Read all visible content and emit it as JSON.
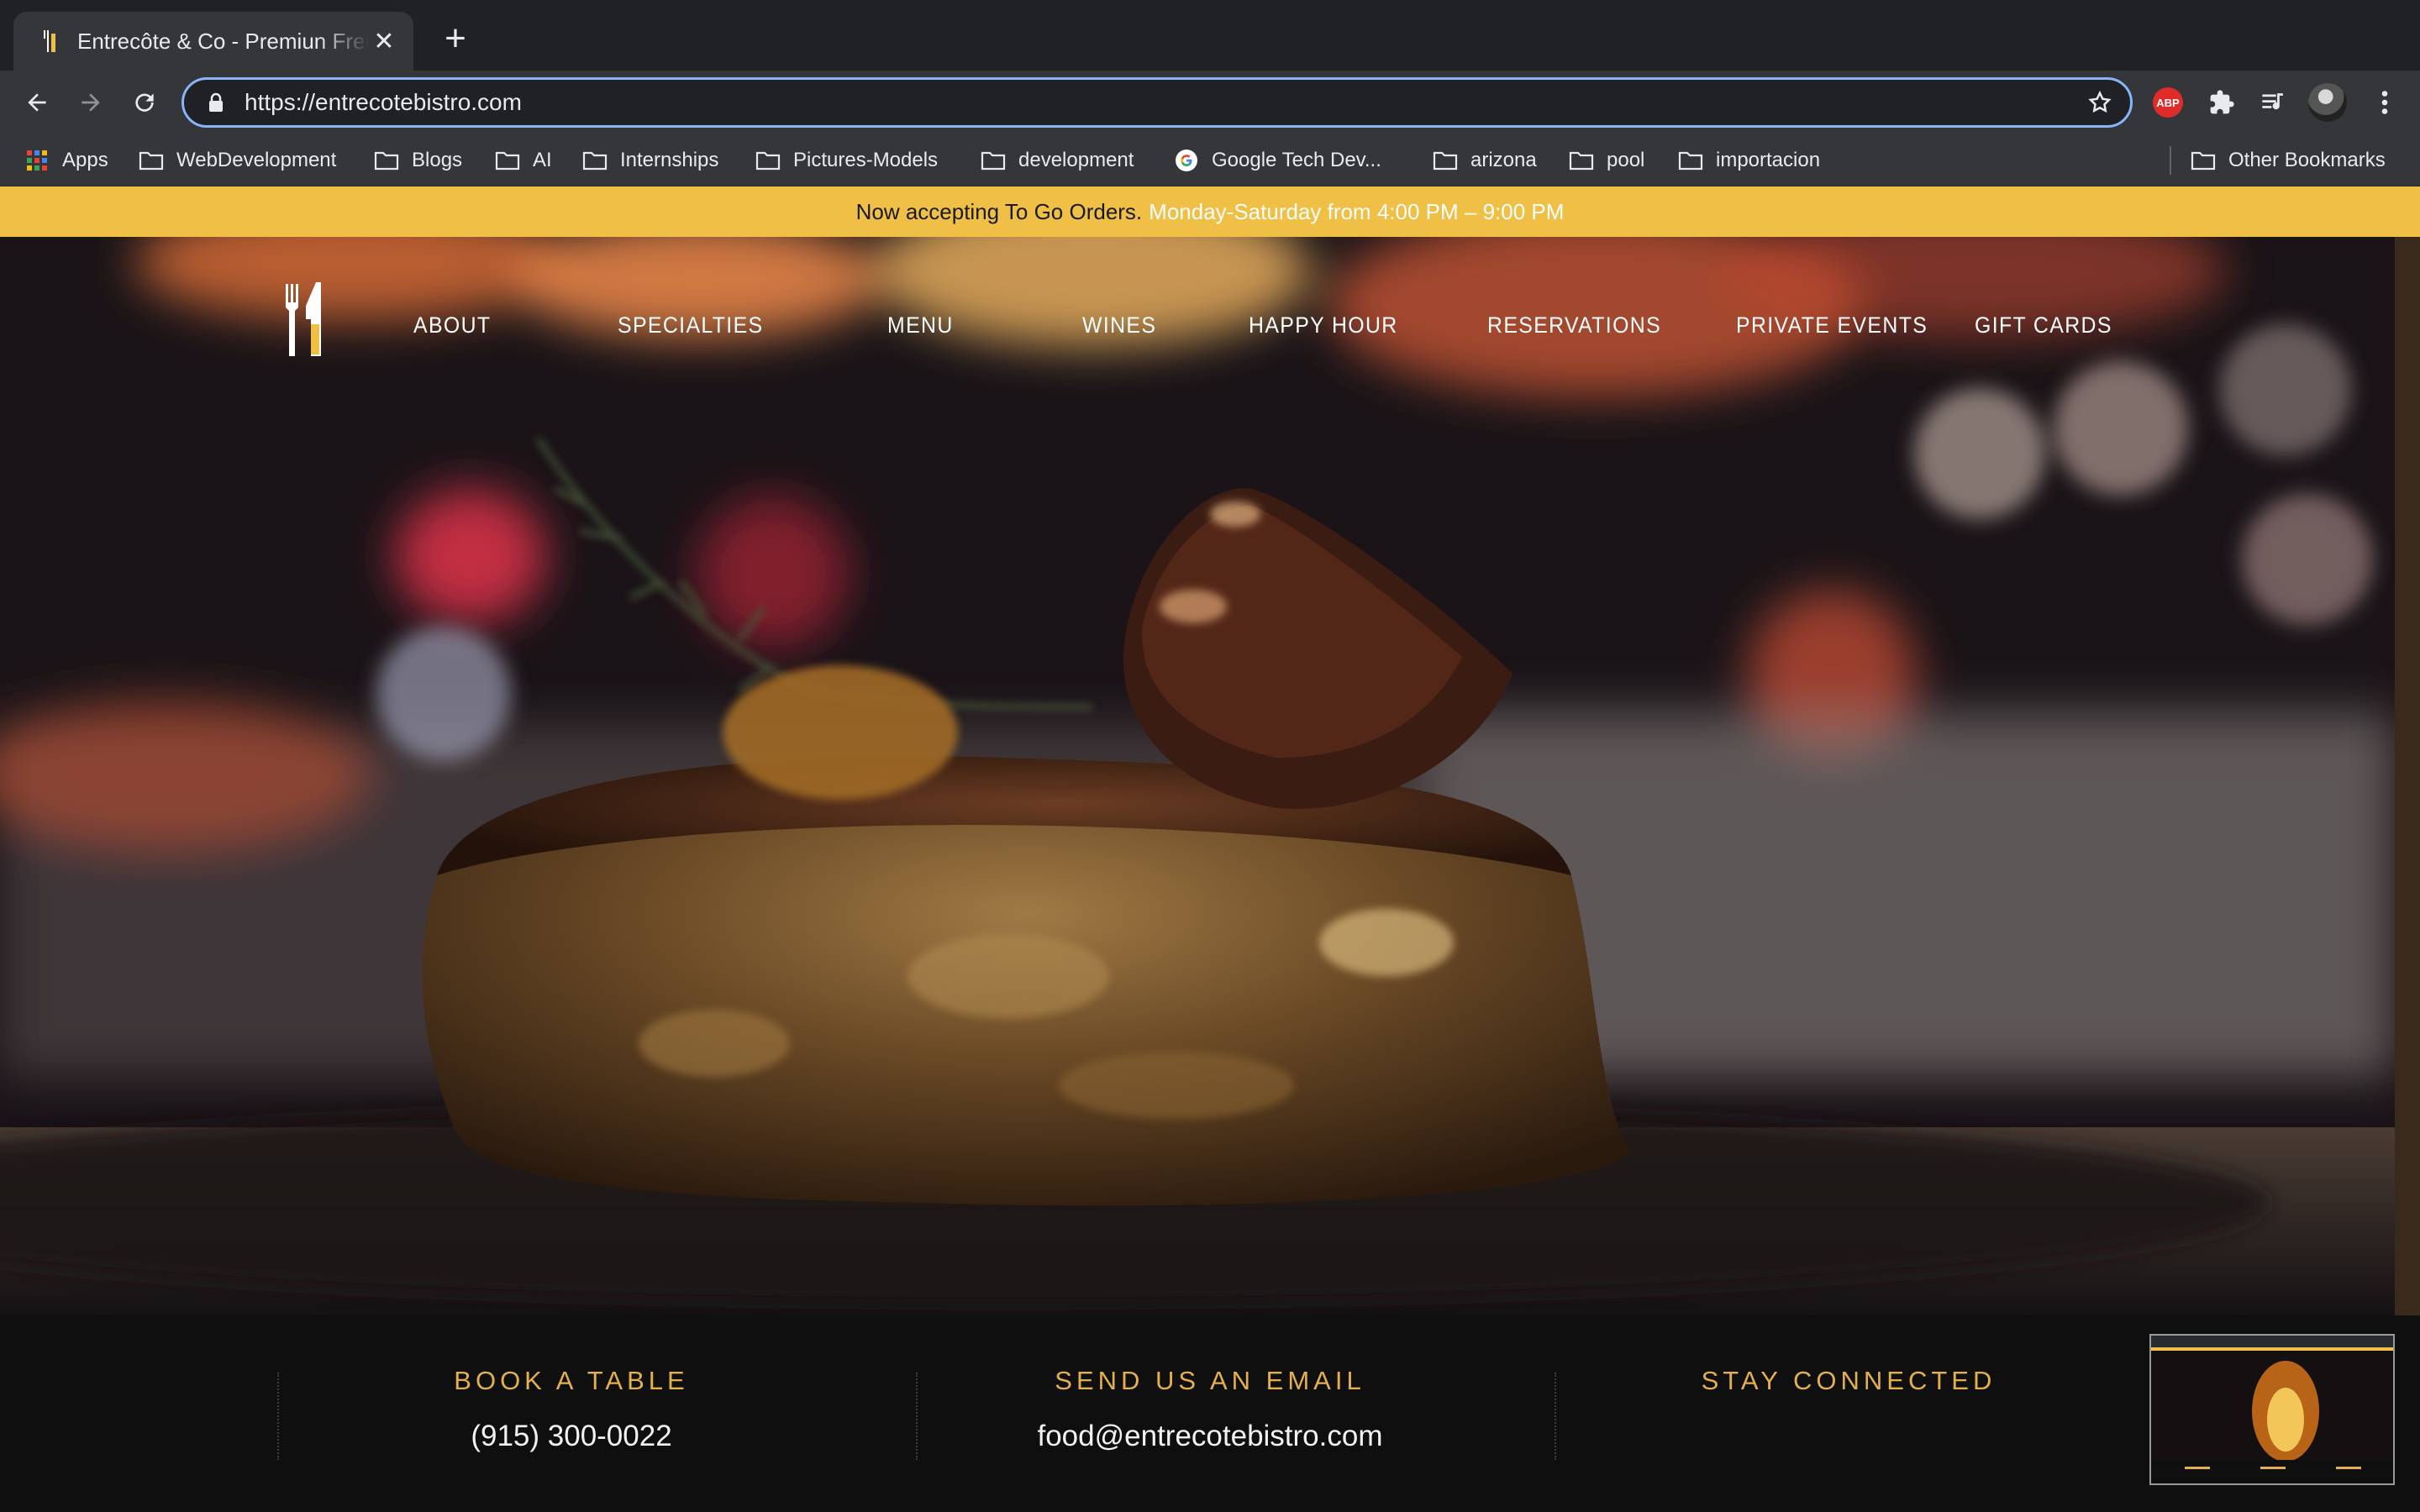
{
  "browser": {
    "tab_title": "Entrecôte & Co - Premiun French Bistro",
    "new_tab_symbol": "+",
    "close_symbol": "✕",
    "url_scheme": "https://",
    "url_host": "entrecotebistro.com",
    "bookmarks": [
      {
        "label": "Apps",
        "icon": "apps-grid-icon"
      },
      {
        "label": "WebDevelopment",
        "icon": "folder-icon"
      },
      {
        "label": "Blogs",
        "icon": "folder-icon"
      },
      {
        "label": "AI",
        "icon": "folder-icon"
      },
      {
        "label": "Internships",
        "icon": "folder-icon"
      },
      {
        "label": "Pictures-Models",
        "icon": "folder-icon"
      },
      {
        "label": "development",
        "icon": "folder-icon"
      },
      {
        "label": "Google Tech Dev...",
        "icon": "google-icon"
      },
      {
        "label": "arizona",
        "icon": "folder-icon"
      },
      {
        "label": "pool",
        "icon": "folder-icon"
      },
      {
        "label": "importacion",
        "icon": "folder-icon"
      }
    ],
    "other_bookmarks": "Other Bookmarks",
    "extension_abp_label": "ABP"
  },
  "announcement": {
    "prefix": "Now accepting To Go Orders.",
    "hours": "Monday-Saturday from 4:00 PM – 9:00 PM"
  },
  "nav": {
    "items": [
      "ABOUT",
      "SPECIALTIES",
      "MENU",
      "WINES",
      "HAPPY HOUR",
      "RESERVATIONS",
      "PRIVATE EVENTS",
      "GIFT CARDS"
    ]
  },
  "footer": {
    "book": {
      "heading": "BOOK A TABLE",
      "value": "(915) 300-0022"
    },
    "email": {
      "heading": "SEND US AN EMAIL",
      "value": "food@entrecotebistro.com"
    },
    "connect": {
      "heading": "STAY CONNECTED"
    }
  },
  "colors": {
    "announcement_bg": "#f0bf45",
    "footer_heading": "#e3b04b",
    "footer_bg": "#0f0f10",
    "omnibox_focus": "#8ab4f8"
  }
}
